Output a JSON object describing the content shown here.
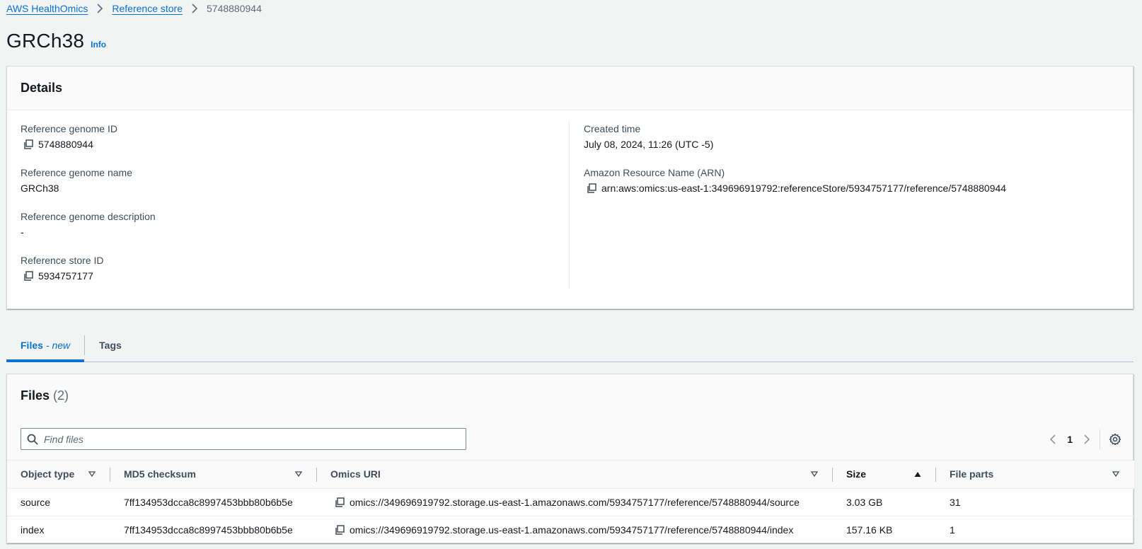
{
  "breadcrumb": {
    "items": [
      "AWS HealthOmics",
      "Reference store"
    ],
    "current": "5748880944"
  },
  "page": {
    "title": "GRCh38",
    "info": "Info"
  },
  "details": {
    "title": "Details",
    "left": [
      {
        "label": "Reference genome ID",
        "value": "5748880944",
        "copy": true
      },
      {
        "label": "Reference genome name",
        "value": "GRCh38",
        "copy": false
      },
      {
        "label": "Reference genome description",
        "value": "-",
        "copy": false
      },
      {
        "label": "Reference store ID",
        "value": "5934757177",
        "copy": true
      }
    ],
    "right": [
      {
        "label": "Created time",
        "value": "July 08, 2024, 11:26 (UTC -5)",
        "copy": false
      },
      {
        "label": "Amazon Resource Name (ARN)",
        "value": "arn:aws:omics:us-east-1:349696919792:referenceStore/5934757177/reference/5748880944",
        "copy": true
      }
    ]
  },
  "tabs": [
    {
      "label": "Files",
      "suffix": "new",
      "active": true
    },
    {
      "label": "Tags",
      "active": false
    }
  ],
  "files": {
    "title": "Files",
    "count": "(2)",
    "search_placeholder": "Find files",
    "page": "1",
    "columns": [
      "Object type",
      "MD5 checksum",
      "Omics URI",
      "Size",
      "File parts"
    ],
    "rows": [
      {
        "object_type": "source",
        "md5": "7ff134953dcca8c8997453bbb80b6b5e",
        "uri": "omics://349696919792.storage.us-east-1.amazonaws.com/5934757177/reference/5748880944/source",
        "size": "3.03 GB",
        "parts": "31"
      },
      {
        "object_type": "index",
        "md5": "7ff134953dcca8c8997453bbb80b6b5e",
        "uri": "omics://349696919792.storage.us-east-1.amazonaws.com/5934757177/reference/5748880944/index",
        "size": "157.16 KB",
        "parts": "1"
      }
    ]
  },
  "icons": {
    "chevron_right": "chevron-right-icon",
    "copy": "copy-icon",
    "search": "search-icon",
    "gear": "gear-icon",
    "sort_down": "caret-down-icon",
    "sort_up": "caret-up-icon"
  },
  "colors": {
    "link": "#0972d3",
    "text": "#16191f",
    "background": "#f2f3f3"
  }
}
